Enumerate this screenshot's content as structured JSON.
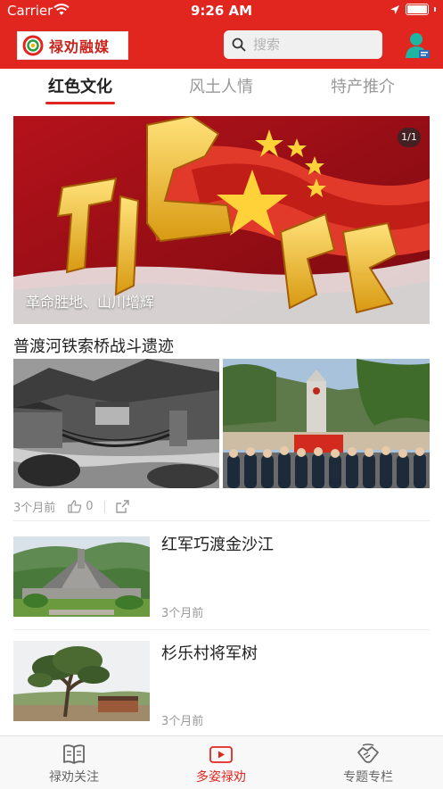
{
  "status_bar": {
    "carrier": "Carrier",
    "time": "9:26 AM"
  },
  "header": {
    "logo_text": "禄劝融媒",
    "search_placeholder": "搜索"
  },
  "tabs": [
    {
      "label": "红色文化",
      "active": true
    },
    {
      "label": "风土人情",
      "active": false
    },
    {
      "label": "特产推介",
      "active": false
    }
  ],
  "banner": {
    "caption": "革命胜地、山川增辉",
    "page_indicator": "1/1"
  },
  "featured_article": {
    "title": "普渡河铁索桥战斗遗迹",
    "time": "3个月前",
    "likes": "0"
  },
  "list_articles": [
    {
      "title": "红军巧渡金沙江",
      "time": "3个月前"
    },
    {
      "title": "杉乐村将军树",
      "time": "3个月前"
    }
  ],
  "bottom_nav": [
    {
      "label": "禄劝关注",
      "icon": "book-icon",
      "active": false
    },
    {
      "label": "多姿禄劝",
      "icon": "video-icon",
      "active": true
    },
    {
      "label": "专题专栏",
      "icon": "handshake-icon",
      "active": false
    }
  ],
  "colors": {
    "brand_red": "#e0261f",
    "inactive_text": "#999999"
  }
}
